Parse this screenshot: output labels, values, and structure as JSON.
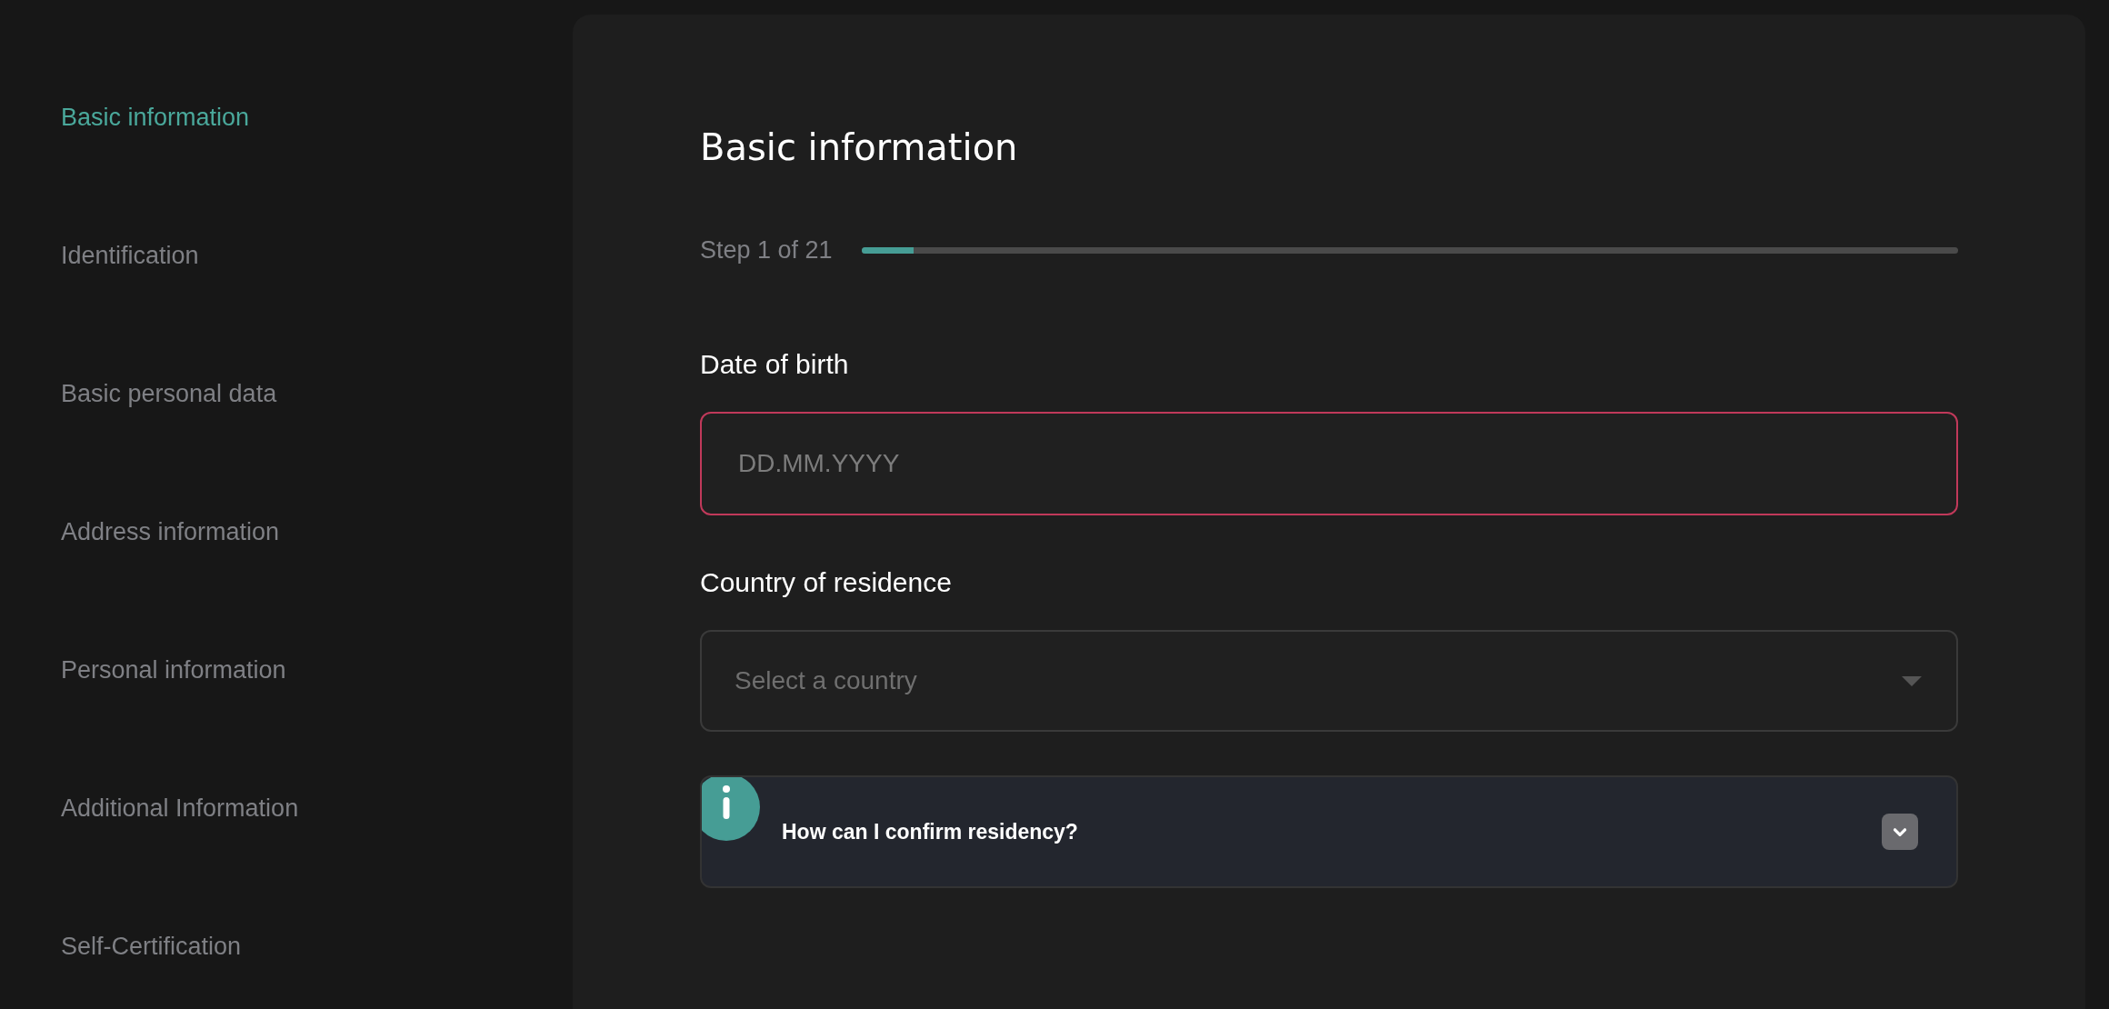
{
  "sidebar": {
    "items": [
      {
        "label": "Basic information",
        "selected": true
      },
      {
        "label": "Identification",
        "selected": false
      },
      {
        "label": "Basic personal data",
        "selected": false
      },
      {
        "label": "Address information",
        "selected": false
      },
      {
        "label": "Personal information",
        "selected": false
      },
      {
        "label": "Additional Information",
        "selected": false
      },
      {
        "label": "Self-Certification",
        "selected": false
      }
    ]
  },
  "form": {
    "title": "Basic information",
    "progress": {
      "text": "Step 1 of 21",
      "level": 0.0476
    },
    "fields": [
      {
        "kind": "text",
        "label": "Date of birth",
        "placeholder": "DD.MM.YYYY",
        "invalid": true
      },
      {
        "kind": "select",
        "label": "Country of residence",
        "placeholder": "Select a country",
        "invalid": false
      }
    ],
    "info": {
      "question": "How can I confirm residency?",
      "expanded": false
    }
  }
}
